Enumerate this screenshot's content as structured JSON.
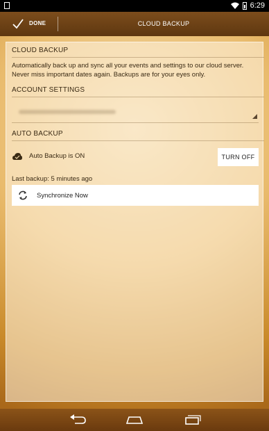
{
  "status_bar": {
    "time": "6:29"
  },
  "action_bar": {
    "done_label": "DONE",
    "title": "CLOUD BACKUP"
  },
  "cloud_backup": {
    "header": "CLOUD BACKUP",
    "description": "Automatically back up and sync all your events and settings to our cloud server. Never miss important dates again. Backups are for your eyes only."
  },
  "account_settings": {
    "header": "ACCOUNT SETTINGS",
    "account": ""
  },
  "auto_backup": {
    "header": "AUTO BACKUP",
    "status_label": "Auto Backup is ON",
    "turn_off_label": "TURN OFF",
    "last_backup": "Last backup: 5 minutes ago",
    "sync_label": "Synchronize Now"
  },
  "icons": {
    "done": "checkmark-icon",
    "cloud": "cloud-check-icon",
    "sync": "sync-icon",
    "back": "back-icon",
    "home": "home-icon",
    "recents": "recents-icon"
  },
  "colors": {
    "action_bar": "#6b4015",
    "background": "#e9bb6d",
    "button_bg": "#ffffff"
  }
}
